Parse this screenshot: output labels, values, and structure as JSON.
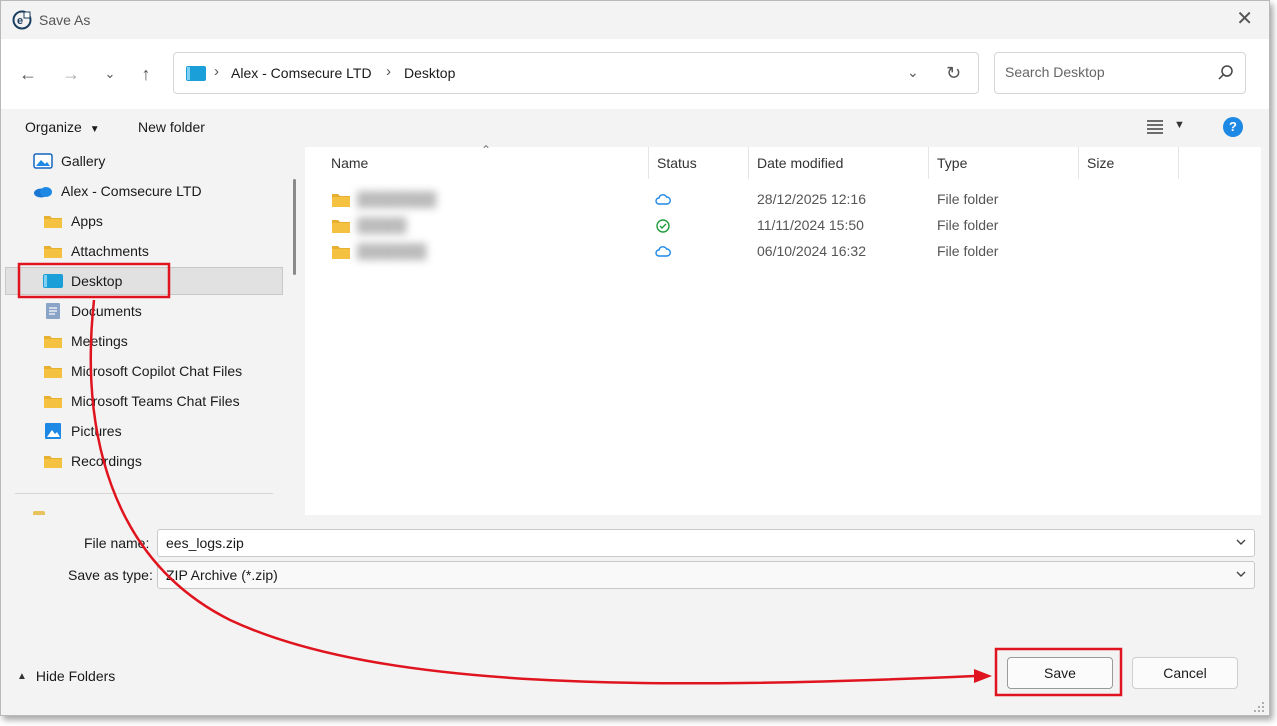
{
  "window": {
    "title": "Save As"
  },
  "nav": {
    "breadcrumb": [
      "Alex - Comsecure LTD",
      "Desktop"
    ],
    "search_placeholder": "Search Desktop"
  },
  "toolbar": {
    "organize": "Organize",
    "new_folder": "New folder"
  },
  "sidebar": {
    "items": [
      {
        "label": "Gallery",
        "icon": "gallery-icon"
      },
      {
        "label": "Alex - Comsecure LTD",
        "icon": "onedrive-cloud-icon"
      },
      {
        "label": "Apps",
        "icon": "folder-icon"
      },
      {
        "label": "Attachments",
        "icon": "folder-icon"
      },
      {
        "label": "Desktop",
        "icon": "desktop-icon",
        "selected": true
      },
      {
        "label": "Documents",
        "icon": "documents-icon"
      },
      {
        "label": "Meetings",
        "icon": "folder-icon"
      },
      {
        "label": "Microsoft Copilot Chat Files",
        "icon": "folder-icon"
      },
      {
        "label": "Microsoft Teams Chat Files",
        "icon": "folder-icon"
      },
      {
        "label": "Pictures",
        "icon": "pictures-icon"
      },
      {
        "label": "Recordings",
        "icon": "folder-icon"
      }
    ]
  },
  "files": {
    "columns": [
      "Name",
      "Status",
      "Date modified",
      "Type",
      "Size"
    ],
    "rows": [
      {
        "name": "████████",
        "status": "cloud-icon",
        "date": "28/12/2025 12:16",
        "type": "File folder"
      },
      {
        "name": "█████",
        "status": "synced-check-icon",
        "date": "11/11/2024 15:50",
        "type": "File folder"
      },
      {
        "name": "███████",
        "status": "cloud-icon",
        "date": "06/10/2024 16:32",
        "type": "File folder"
      }
    ]
  },
  "form": {
    "file_name_label": "File name:",
    "file_name_value": "ees_logs.zip",
    "save_type_label": "Save as type:",
    "save_type_value": "ZIP Archive (*.zip)"
  },
  "footer": {
    "hide_folders": "Hide Folders",
    "save": "Save",
    "cancel": "Cancel"
  },
  "colors": {
    "accent": "#1e88e5",
    "annotation": "#e0141e",
    "folder": "#f5c140"
  }
}
